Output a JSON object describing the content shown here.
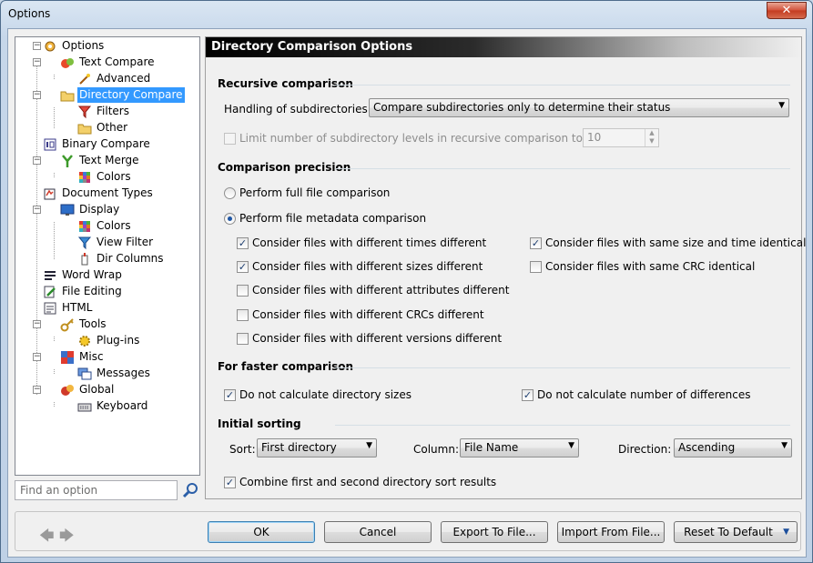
{
  "window": {
    "title": "Options",
    "close_glyph": "✕"
  },
  "tree": {
    "items": [
      {
        "label": "Options",
        "icon": "options-icon"
      },
      {
        "label": "Text Compare",
        "icon": "text-compare-icon"
      },
      {
        "label": "Advanced",
        "icon": "wand-icon"
      },
      {
        "label": "Directory Compare",
        "icon": "folder-icon"
      },
      {
        "label": "Filters",
        "icon": "filter-icon"
      },
      {
        "label": "Other",
        "icon": "folder-icon"
      },
      {
        "label": "Binary Compare",
        "icon": "binary-icon"
      },
      {
        "label": "Text Merge",
        "icon": "merge-icon"
      },
      {
        "label": "Colors",
        "icon": "colors-icon"
      },
      {
        "label": "Document Types",
        "icon": "document-types-icon"
      },
      {
        "label": "Display",
        "icon": "monitor-icon"
      },
      {
        "label": "Colors",
        "icon": "colors-icon"
      },
      {
        "label": "View Filter",
        "icon": "filter-icon"
      },
      {
        "label": "Dir Columns",
        "icon": "columns-icon"
      },
      {
        "label": "Word Wrap",
        "icon": "word-wrap-icon"
      },
      {
        "label": "File Editing",
        "icon": "file-editing-icon"
      },
      {
        "label": "HTML",
        "icon": "html-icon"
      },
      {
        "label": "Tools",
        "icon": "key-icon"
      },
      {
        "label": "Plug-ins",
        "icon": "plugin-icon"
      },
      {
        "label": "Misc",
        "icon": "misc-icon"
      },
      {
        "label": "Messages",
        "icon": "messages-icon"
      },
      {
        "label": "Global",
        "icon": "global-icon"
      },
      {
        "label": "Keyboard",
        "icon": "keyboard-icon"
      }
    ],
    "selected": "Directory Compare",
    "expander_glyph": "−"
  },
  "search": {
    "placeholder": "Find an option"
  },
  "panel": {
    "header": "Directory Comparison Options",
    "recursive": {
      "title": "Recursive comparison",
      "handling_label": "Handling of subdirectories:",
      "handling_value": "Compare subdirectories only to determine their status",
      "limit_label": "Limit number of subdirectory levels in recursive comparison to",
      "limit_checked": false,
      "limit_value": "10"
    },
    "precision": {
      "title": "Comparison precision",
      "full_label": "Perform full file comparison",
      "metadata_label": "Perform file metadata comparison",
      "selected": "metadata",
      "left_options": [
        {
          "label": "Consider files with different times different",
          "checked": true
        },
        {
          "label": "Consider files with different sizes different",
          "checked": true
        },
        {
          "label": "Consider files with different attributes different",
          "checked": false
        },
        {
          "label": "Consider files with different CRCs different",
          "checked": false
        },
        {
          "label": "Consider files with different versions different",
          "checked": false
        }
      ],
      "right_options": [
        {
          "label": "Consider files with same size and time identical",
          "checked": true
        },
        {
          "label": "Consider files with same CRC identical",
          "checked": false
        }
      ]
    },
    "faster": {
      "title": "For faster comparison",
      "dir_sizes_label": "Do not calculate directory sizes",
      "dir_sizes_checked": true,
      "num_diff_label": "Do not calculate number of differences",
      "num_diff_checked": true
    },
    "sorting": {
      "title": "Initial sorting",
      "sort_label": "Sort:",
      "sort_value": "First directory",
      "column_label": "Column:",
      "column_value": "File Name",
      "direction_label": "Direction:",
      "direction_value": "Ascending",
      "combine_label": "Combine first and second directory sort results",
      "combine_checked": true
    }
  },
  "footer": {
    "back_glyph": "🡄",
    "forward_glyph": "🡆",
    "ok": "OK",
    "cancel": "Cancel",
    "export": "Export To File...",
    "import": "Import From File...",
    "reset": "Reset To Default"
  },
  "glyphs": {
    "check": "✓",
    "dropdown": "▼",
    "spin_up": "▲",
    "spin_down": "▼"
  },
  "colors": {
    "selection": "#3399ff",
    "header_bg": "#000000",
    "section_rule": "#d5dfe5"
  }
}
